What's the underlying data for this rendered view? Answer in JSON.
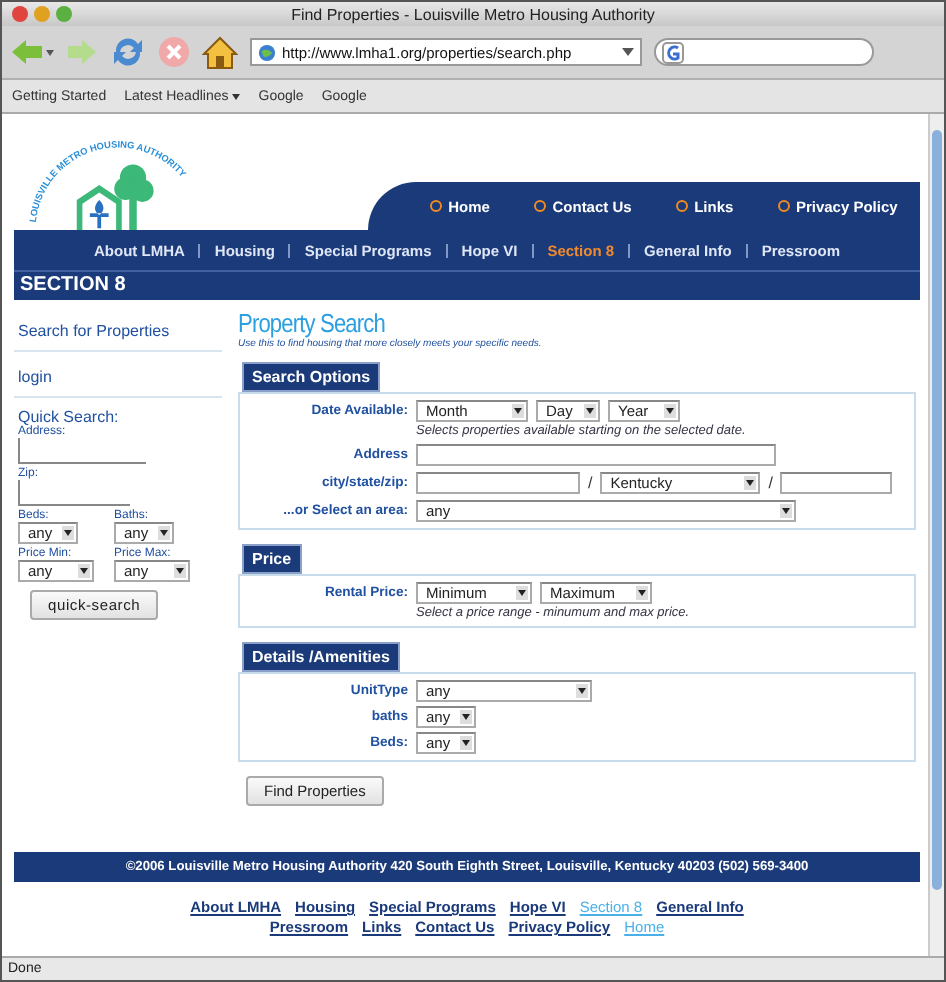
{
  "window": {
    "title": "Find Properties - Louisville Metro Housing Authority"
  },
  "toolbar": {
    "url": "http://www.lmha1.org/properties/search.php"
  },
  "bookmarks": [
    {
      "label": "Getting Started",
      "menu": false
    },
    {
      "label": "Latest Headlines",
      "menu": true
    },
    {
      "label": "Google",
      "menu": false
    },
    {
      "label": "Google",
      "menu": false
    }
  ],
  "header": {
    "logo_text": "LOUISVILLE METRO HOUSING AUTHORITY",
    "top_nav": [
      "Home",
      "Contact Us",
      "Links",
      "Privacy Policy"
    ],
    "main_nav": [
      {
        "label": "About LMHA",
        "selected": false
      },
      {
        "label": "Housing",
        "selected": false
      },
      {
        "label": "Special Programs",
        "selected": false
      },
      {
        "label": "Hope VI",
        "selected": false
      },
      {
        "label": "Section 8",
        "selected": true
      },
      {
        "label": "General Info",
        "selected": false
      },
      {
        "label": "Pressroom",
        "selected": false
      }
    ],
    "section_title": "SECTION 8"
  },
  "sidebar": {
    "links": [
      "Search for Properties",
      "login"
    ],
    "quick_search": {
      "title": "Quick Search:",
      "address_label": "Address:",
      "zip_label": "Zip:",
      "beds_label": "Beds:",
      "beds_value": "any",
      "baths_label": "Baths:",
      "baths_value": "any",
      "price_min_label": "Price Min:",
      "price_min_value": "any",
      "price_max_label": "Price Max:",
      "price_max_value": "any",
      "button": "quick-search"
    }
  },
  "content": {
    "title": "Property Search",
    "subtitle": "Use this to find housing that more closely meets your specific needs.",
    "search_options": {
      "heading": "Search Options",
      "date_label": "Date Available:",
      "month": "Month",
      "day": "Day",
      "year": "Year",
      "date_hint": "Selects properties available starting on the selected date.",
      "address_label": "Address",
      "city_label": "city/state/zip:",
      "city_separator": "/",
      "state": "Kentucky",
      "zip_separator": "/",
      "area_label": "...or Select an area:",
      "area": "any"
    },
    "price": {
      "heading": "Price",
      "label": "Rental Price:",
      "min": "Minimum",
      "max": "Maximum",
      "hint": "Select a price range - minumum and max price."
    },
    "details": {
      "heading": "Details /Amenities",
      "unit_label": "UnitType",
      "unit": "any",
      "baths_label": "baths",
      "baths": "any",
      "beds_label": "Beds:",
      "beds": "any"
    },
    "submit": "Find Properties"
  },
  "footer": {
    "bar": "©2006 Louisville Metro Housing Authority  420 South Eighth Street, Louisville, Kentucky 40203  (502) 569-3400",
    "links": [
      {
        "label": "About LMHA",
        "selected": false
      },
      {
        "label": "Housing",
        "selected": false
      },
      {
        "label": "Special Programs",
        "selected": false
      },
      {
        "label": "Hope VI",
        "selected": false
      },
      {
        "label": "Section 8",
        "selected": true
      },
      {
        "label": "General Info",
        "selected": false
      },
      {
        "label": "Pressroom",
        "selected": false
      },
      {
        "label": "Links",
        "selected": false
      },
      {
        "label": "Contact Us",
        "selected": false
      },
      {
        "label": "Privacy Policy",
        "selected": false
      },
      {
        "label": "Home",
        "selected": true
      }
    ]
  },
  "status": "Done"
}
